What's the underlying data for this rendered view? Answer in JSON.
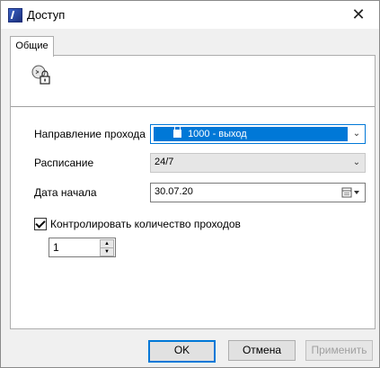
{
  "window": {
    "title": "Доступ",
    "close_glyph": "✕"
  },
  "tabs": [
    {
      "label": "Общие"
    }
  ],
  "fields": {
    "direction": {
      "label": "Направление прохода",
      "value": "1000 - выход"
    },
    "schedule": {
      "label": "Расписание",
      "value": "24/7"
    },
    "start_date": {
      "label": "Дата начала",
      "value": "30.07.20"
    }
  },
  "limit": {
    "label": "Контролировать количество проходов",
    "checked": true,
    "count": "1"
  },
  "buttons": {
    "ok": "OK",
    "cancel": "Отмена",
    "apply": "Применить"
  },
  "colors": {
    "accent": "#0078d7",
    "panel": "#ffffff",
    "window_bg": "#f0f0f0"
  },
  "icons": {
    "app": "app-logo-icon",
    "tab_header": "access-lock-icon",
    "dropdown": "chevron-down-icon",
    "calendar": "calendar-icon",
    "spin_up": "triangle-up-icon",
    "spin_down": "triangle-down-icon"
  }
}
